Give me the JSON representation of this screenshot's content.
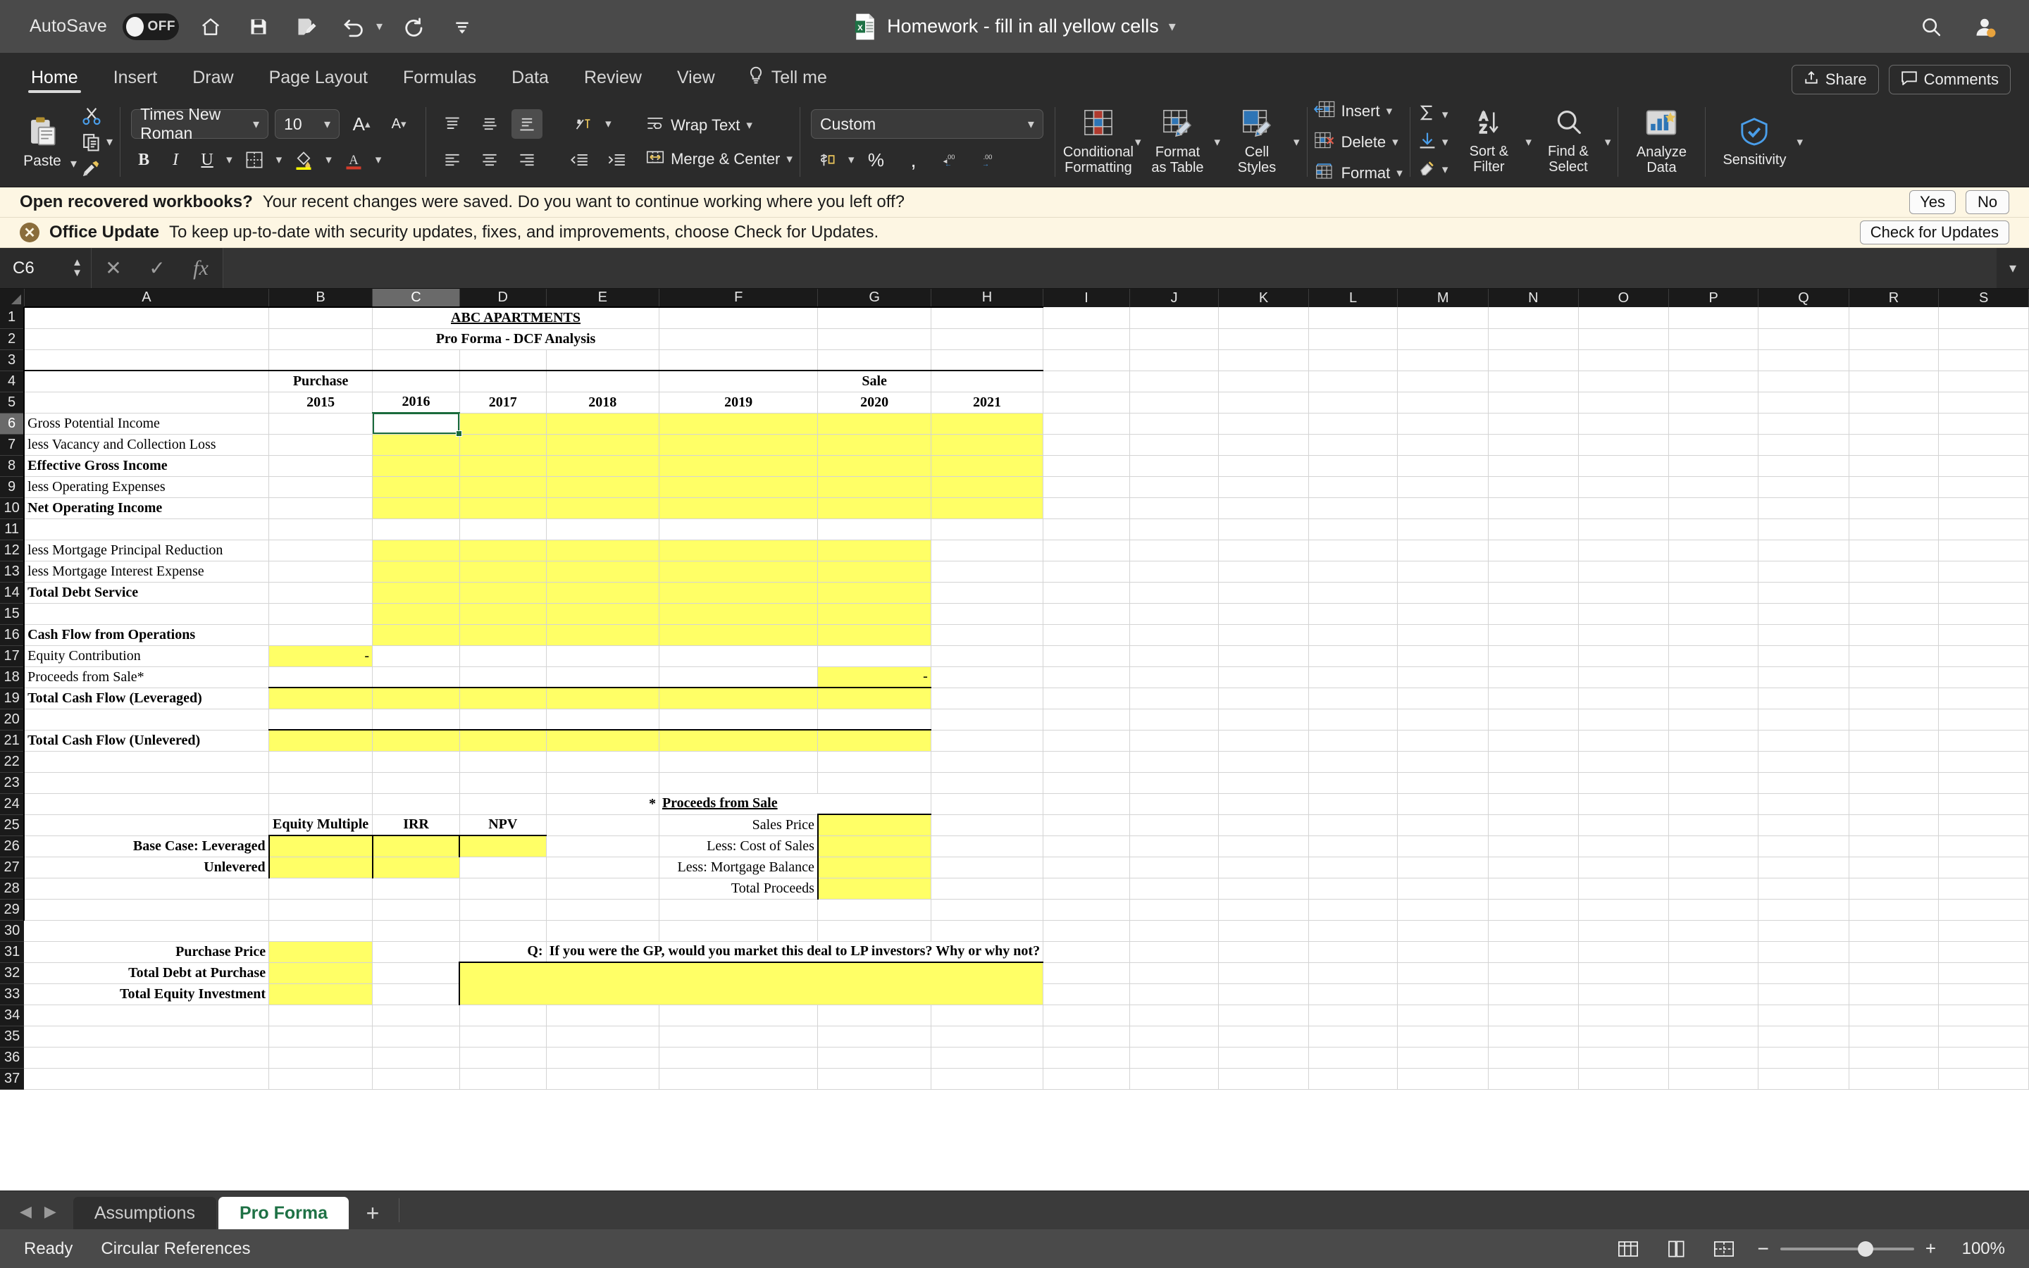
{
  "titlebar": {
    "autosave_label": "AutoSave",
    "autosave_state": "OFF",
    "document_title": "Homework - fill in all yellow cells",
    "icons": [
      "home-icon",
      "save-icon",
      "save-as-icon",
      "undo-icon",
      "redo-icon",
      "customize-toolbar-icon"
    ],
    "search_icon": "search-icon",
    "account_icon": "account-icon"
  },
  "ribbon_tabs": {
    "tabs": [
      {
        "label": "Home",
        "active": true
      },
      {
        "label": "Insert",
        "active": false
      },
      {
        "label": "Draw",
        "active": false
      },
      {
        "label": "Page Layout",
        "active": false
      },
      {
        "label": "Formulas",
        "active": false
      },
      {
        "label": "Data",
        "active": false
      },
      {
        "label": "Review",
        "active": false
      },
      {
        "label": "View",
        "active": false
      }
    ],
    "tell_me": "Tell me",
    "share": "Share",
    "comments": "Comments"
  },
  "ribbon": {
    "paste": "Paste",
    "font_name": "Times New Roman",
    "font_size": "10",
    "grow_font": "A",
    "shrink_font": "A",
    "bold": "B",
    "italic": "I",
    "underline": "U",
    "wrap_text": "Wrap Text",
    "merge_center": "Merge & Center",
    "number_format": "Custom",
    "percent": "%",
    "comma": ",",
    "conditional_formatting": "Conditional\nFormatting",
    "conditional_formatting_l1": "Conditional",
    "conditional_formatting_l2": "Formatting",
    "format_as_table_l1": "Format",
    "format_as_table_l2": "as Table",
    "cell_styles_l1": "Cell",
    "cell_styles_l2": "Styles",
    "insert": "Insert",
    "delete": "Delete",
    "format": "Format",
    "sort_filter_l1": "Sort &",
    "sort_filter_l2": "Filter",
    "find_select_l1": "Find &",
    "find_select_l2": "Select",
    "analyze_data_l1": "Analyze",
    "analyze_data_l2": "Data",
    "sensitivity": "Sensitivity"
  },
  "notices": [
    {
      "title": "Open recovered workbooks?",
      "text": "Your recent changes were saved. Do you want to continue working where you left off?",
      "buttons": [
        "Yes",
        "No"
      ],
      "has_close": false
    },
    {
      "title": "Office Update",
      "text": "To keep up-to-date with security updates, fixes, and improvements, choose Check for Updates.",
      "buttons": [
        "Check for Updates"
      ],
      "has_close": true
    }
  ],
  "formula_bar": {
    "name_box": "C6",
    "cancel_icon": "cancel-icon",
    "enter_icon": "confirm-icon",
    "function_icon": "insert-function-icon",
    "formula_value": ""
  },
  "grid": {
    "columns": [
      "A",
      "B",
      "C",
      "D",
      "E",
      "F",
      "G",
      "H",
      "I",
      "J",
      "K",
      "L",
      "M",
      "N",
      "O",
      "P",
      "Q",
      "R",
      "S"
    ],
    "selected_column": "C",
    "selected_row": "6",
    "selected_cell": "C6",
    "rows": [
      "1",
      "2",
      "3",
      "4",
      "5",
      "6",
      "7",
      "8",
      "9",
      "10",
      "11",
      "12",
      "13",
      "14",
      "15",
      "16",
      "17",
      "18",
      "19",
      "20",
      "21",
      "22",
      "23",
      "24",
      "25",
      "26",
      "27",
      "28",
      "29",
      "30",
      "31",
      "32",
      "33",
      "34",
      "35",
      "36",
      "37"
    ]
  },
  "sheet_content": {
    "title_main": "ABC APARTMENTS",
    "title_sub": "Pro Forma - DCF Analysis",
    "header_purchase": "Purchase",
    "header_sale": "Sale",
    "years": [
      "2015",
      "2016",
      "2017",
      "2018",
      "2019",
      "2020",
      "2021"
    ],
    "line_items": [
      {
        "row": 6,
        "label": "Gross Potential Income",
        "bold": false
      },
      {
        "row": 7,
        "label": "less Vacancy and Collection Loss",
        "bold": false
      },
      {
        "row": 8,
        "label": "Effective Gross Income",
        "bold": true
      },
      {
        "row": 9,
        "label": "less Operating Expenses",
        "bold": false
      },
      {
        "row": 10,
        "label": "Net Operating Income",
        "bold": true
      },
      {
        "row": 12,
        "label": "less Mortgage Principal Reduction",
        "bold": false
      },
      {
        "row": 13,
        "label": "less Mortgage Interest Expense",
        "bold": false
      },
      {
        "row": 14,
        "label": "Total Debt Service",
        "bold": true
      },
      {
        "row": 16,
        "label": "Cash Flow from Operations",
        "bold": true
      },
      {
        "row": 17,
        "label": "Equity Contribution",
        "bold": false
      },
      {
        "row": 18,
        "label": "Proceeds from Sale*",
        "bold": false
      },
      {
        "row": 19,
        "label": "Total Cash Flow (Leveraged)",
        "bold": true
      },
      {
        "row": 21,
        "label": "Total Cash Flow (Unlevered)",
        "bold": true
      }
    ],
    "equity_contribution_value": "-",
    "proceeds_from_sale_value": "-",
    "metrics": {
      "col_headers": [
        "Equity Multiple",
        "IRR",
        "NPV"
      ],
      "row_labels": [
        "Base Case:  Leveraged",
        "Unlevered"
      ]
    },
    "proceeds_block": {
      "heading_marker": "*",
      "heading": "Proceeds from Sale",
      "rows": [
        "Sales Price",
        "Less: Cost of Sales",
        "Less: Mortgage Balance",
        "Total Proceeds"
      ]
    },
    "summary": {
      "rows": [
        "Purchase Price",
        "Total Debt at Purchase",
        "Total Equity Investment"
      ]
    },
    "question": {
      "prefix": "Q:",
      "text": "If you were the GP, would you market this deal to LP investors? Why or why not?"
    }
  },
  "sheet_tabs": {
    "tabs": [
      {
        "label": "Assumptions",
        "active": false
      },
      {
        "label": "Pro Forma",
        "active": true
      }
    ],
    "add_label": "+"
  },
  "status_bar": {
    "status": "Ready",
    "message": "Circular References",
    "zoom": "100%",
    "views": [
      "normal-view-icon",
      "page-layout-view-icon",
      "page-break-view-icon"
    ]
  },
  "colors": {
    "yellow_fill": "#ffff66",
    "excel_green": "#1e7145",
    "notice_bg": "#fdf6e3",
    "titlebar_bg": "#4a4a4a",
    "ribbon_bg": "#2b2b2b"
  }
}
